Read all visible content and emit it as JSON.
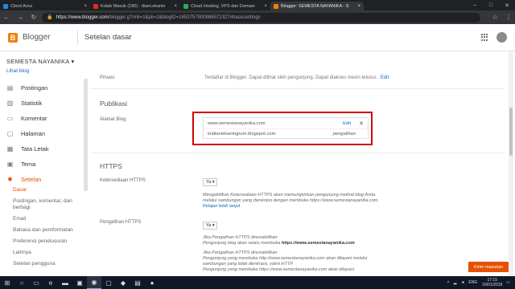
{
  "browser": {
    "tabs": [
      {
        "title": "Client Area",
        "color": "#1e88e5"
      },
      {
        "title": "Kotak Masuk (180) - diani.ekanin",
        "color": "#d93025"
      },
      {
        "title": "Cloud Hosting, VPS dan Domain",
        "color": "#34a853"
      },
      {
        "title": "Blogger: SEMESTA NAYANIKA - S",
        "color": "#f57d00",
        "active": true
      }
    ],
    "url_host": "https://www.blogger.com",
    "url_path": "/blogger.g?rinli=1&pli=1&blogID=1653757800886572327#basicsettings"
  },
  "header": {
    "brand": "Blogger",
    "page_title": "Setelan dasar",
    "logo_letter": "B"
  },
  "sidebar": {
    "blog_name": "SEMESTA NAYANIKA",
    "view_blog": "Lihat blog",
    "items": [
      {
        "label": "Postingan",
        "icon": "document-icon"
      },
      {
        "label": "Statistik",
        "icon": "stats-icon"
      },
      {
        "label": "Komentar",
        "icon": "comment-icon"
      },
      {
        "label": "Halaman",
        "icon": "page-icon"
      },
      {
        "label": "Tata Letak",
        "icon": "layout-icon"
      },
      {
        "label": "Tema",
        "icon": "theme-icon"
      },
      {
        "label": "Setelan",
        "icon": "gear-icon",
        "active": true
      }
    ],
    "subitems": [
      "Dasar",
      "Postingan, komentar, dan berbagi",
      "Email",
      "Bahasa dan pemformatan",
      "Preferensi penelusuran",
      "Lainnya",
      "Setelan pengguna"
    ]
  },
  "main": {
    "privasi_label": "Privasi",
    "privasi_value": "Terdaftar di Blogger. Dapat dilihat oleh pengunjung. Dapat diakses mesin telusur.",
    "privasi_edit": "Edit",
    "publikasi_title": "Publikasi",
    "alamat_label": "Alamat Blog",
    "alamat_rows": [
      {
        "value": "www.semestanayanika.com",
        "action": "Edit",
        "close": "✕"
      },
      {
        "value": "inidianiekaningrum.blogspot.com",
        "action": "pengalihan"
      }
    ],
    "https_title": "HTTPS",
    "ketersediaan_label": "Ketersediaan HTTPS",
    "ketersediaan_value": "Ya",
    "ketersediaan_desc": "Mengaktifkan Ketersediaan HTTPS akan memungkinkan pengunjung melihat blog Anda melalui sambungan yang dienkripsi dengan membuka https://www.semestanayanika.com.",
    "pelajari": "Pelajari lebih lanjut",
    "pengalihan_label": "Pengalihan HTTPS",
    "pengalihan_value": "Ya",
    "pengalihan_desc1_a": "Jika Pengalihan HTTPS dinonaktifkan:",
    "pengalihan_desc1_b": "Pengunjung blog akan selalu membuka",
    "pengalihan_desc1_c": "https://www.semestanayanika.com",
    "pengalihan_desc2_a": "Jika Pengalihan HTTPS dinonaktifkan:",
    "pengalihan_desc2_b": "Pengunjung yang membuka http://www.semestanayanika.com akan dilayani melalui sambungan yang tidak dienkripsi, yakni HTTP.",
    "pengalihan_desc2_c": "Pengunjung yang membuka https://www.semestanayanika.com akan dilayani"
  },
  "feedback": "Kirim masukan",
  "taskbar": {
    "lang": "ENG",
    "time": "17:15",
    "date": "16/01/2019"
  }
}
